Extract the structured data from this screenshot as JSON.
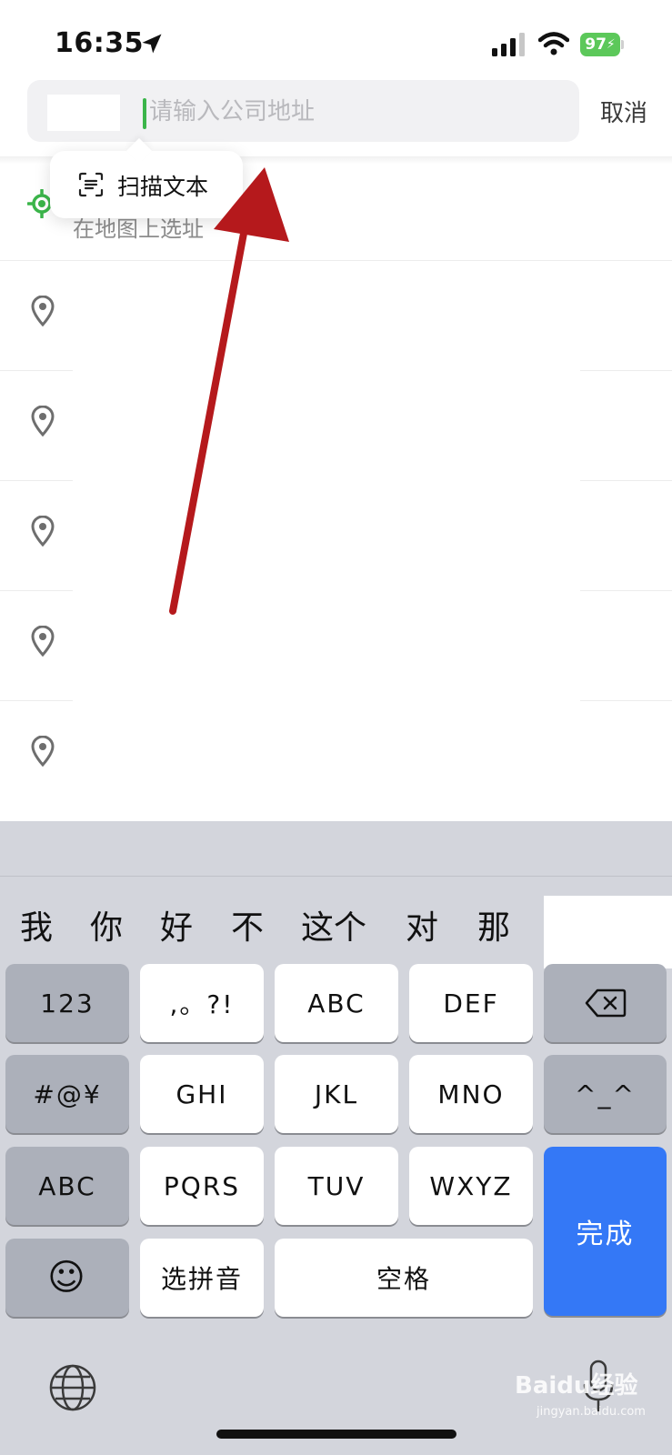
{
  "status_bar": {
    "time": "16:35",
    "battery": "97"
  },
  "search": {
    "placeholder": "请输入公司地址",
    "cancel_label": "取消"
  },
  "popup": {
    "label": "扫描文本"
  },
  "map_pick": {
    "label": "在地图上选址"
  },
  "keyboard": {
    "candidates": [
      "我",
      "你",
      "好",
      "不",
      "这个",
      "对",
      "那"
    ],
    "row1": [
      "123",
      ",。?!",
      "ABC",
      "DEF"
    ],
    "row2": [
      "#@¥",
      "GHI",
      "JKL",
      "MNO",
      "^_^"
    ],
    "row3": [
      "ABC",
      "PQRS",
      "TUV",
      "WXYZ"
    ],
    "row4": [
      "选拼音",
      "空格"
    ],
    "done_label": "完成",
    "emoji": "☺"
  },
  "watermark": {
    "main": "Baidu经验",
    "sub": "jingyan.baidu.com"
  },
  "colors": {
    "accent_green": "#3bb54a",
    "done_blue": "#3478f6",
    "annotation_red": "#b5191c"
  }
}
